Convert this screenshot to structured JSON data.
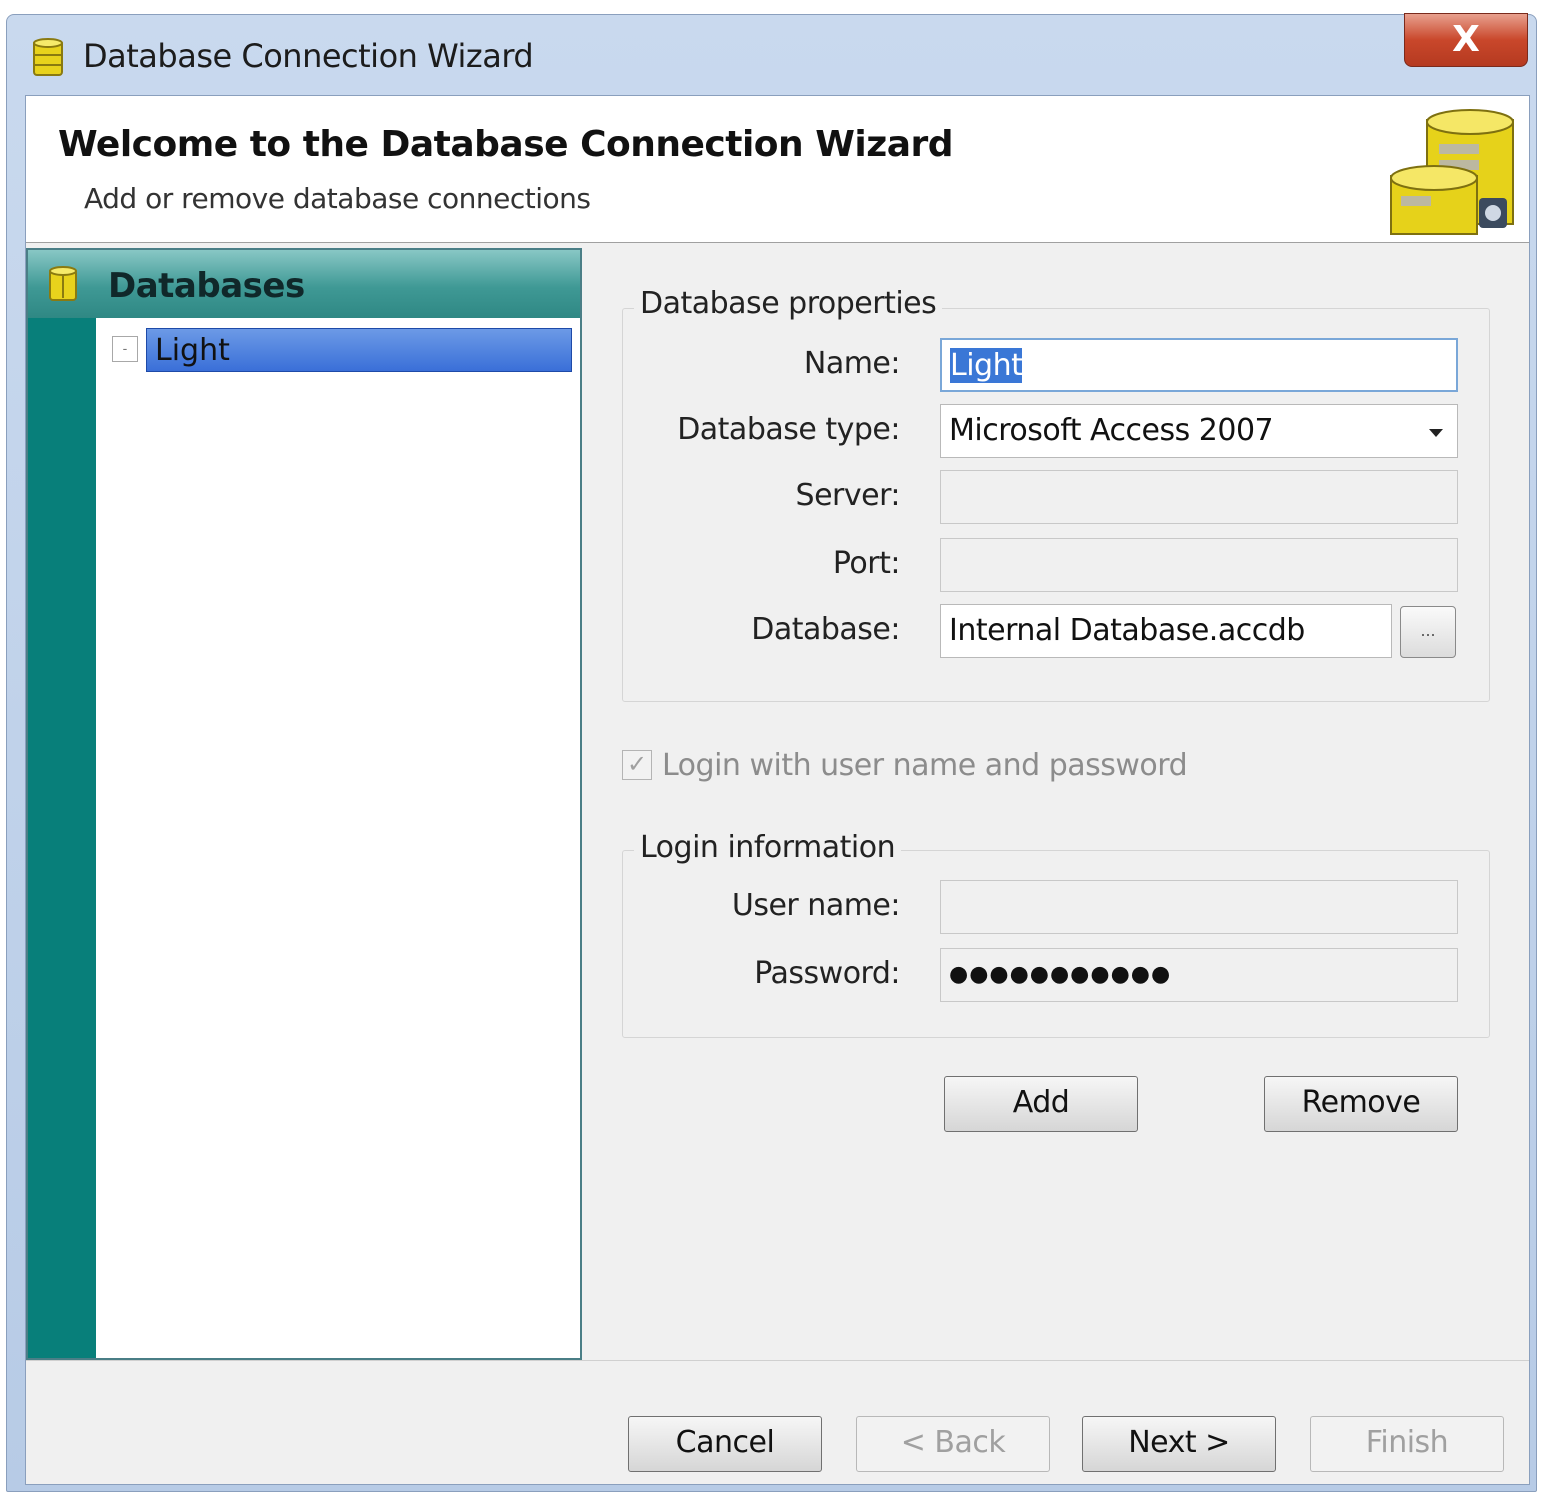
{
  "window": {
    "title": "Database Connection Wizard",
    "close_label": "X"
  },
  "header": {
    "title": "Welcome to the Database Connection Wizard",
    "subtitle": "Add or remove database connections"
  },
  "sidebar": {
    "heading": "Databases",
    "items": [
      {
        "label": "Light",
        "selected": true,
        "expander": "-"
      }
    ]
  },
  "database_properties": {
    "group_label": "Database properties",
    "name_label": "Name:",
    "name_value": "Light",
    "type_label": "Database type:",
    "type_value": "Microsoft Access 2007",
    "server_label": "Server:",
    "server_value": "",
    "port_label": "Port:",
    "port_value": "",
    "database_label": "Database:",
    "database_value": "Internal Database.accdb",
    "browse_label": "..."
  },
  "login_checkbox": {
    "label": "Login with user name and password",
    "checked": true,
    "check_mark": "✓"
  },
  "login_information": {
    "group_label": "Login information",
    "username_label": "User name:",
    "username_value": "",
    "password_label": "Password:",
    "password_value": "●●●●●●●●●●●"
  },
  "actions": {
    "add_label": "Add",
    "remove_label": "Remove"
  },
  "footer": {
    "cancel_label": "Cancel",
    "back_label": "< Back",
    "next_label": "Next >",
    "finish_label": "Finish"
  },
  "colors": {
    "sidebar_strip": "#087f7a",
    "selection": "#3a6fd8",
    "close_button": "#c9472b",
    "db_icon": "#e8d21c"
  },
  "icons": {
    "app": "database-icon",
    "header": "database-stack-icon",
    "sidebar": "database-icon",
    "close": "close-icon",
    "dropdown": "chevron-down-icon"
  }
}
